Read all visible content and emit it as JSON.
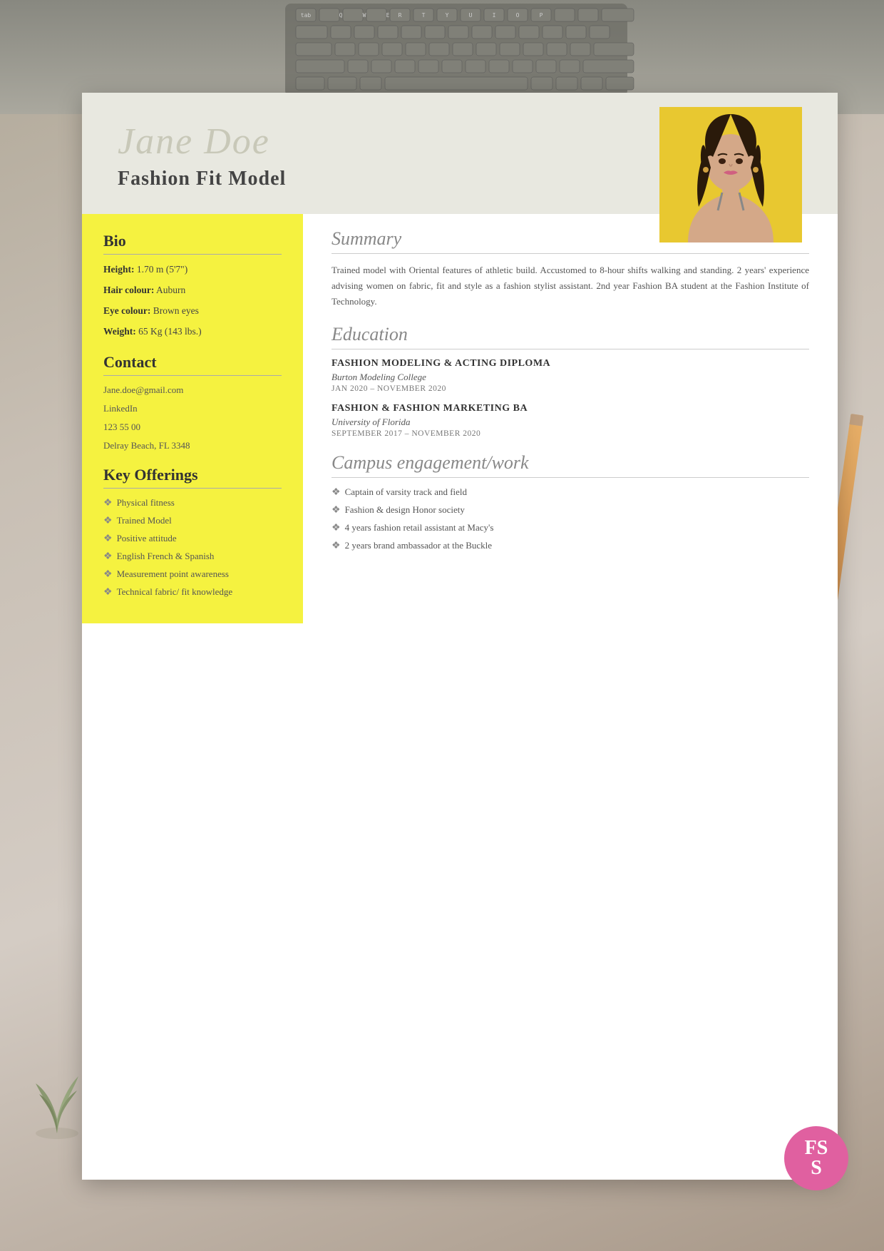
{
  "background": {
    "color": "#c0b8b0"
  },
  "resume": {
    "header": {
      "name": "Jane Doe",
      "title": "Fashion Fit Model"
    },
    "bio": {
      "section_title": "Bio",
      "items": [
        {
          "label": "Height:",
          "value": "1.70 m (5'7\")"
        },
        {
          "label": "Hair colour:",
          "value": "Auburn"
        },
        {
          "label": "Eye colour:",
          "value": "Brown eyes"
        },
        {
          "label": "Weight:",
          "value": "65 Kg (143 lbs.)"
        }
      ]
    },
    "contact": {
      "section_title": "Contact",
      "items": [
        "Jane.doe@gmail.com",
        "LinkedIn",
        "123 55 00",
        "Delray Beach, FL 3348"
      ]
    },
    "offerings": {
      "section_title": "Key Offerings",
      "items": [
        "Physical fitness",
        "Trained Model",
        "Positive attitude",
        "English French & Spanish",
        "Measurement point awareness",
        "Technical fabric/ fit knowledge"
      ]
    },
    "summary": {
      "section_title": "Summary",
      "text": "Trained model with Oriental features of athletic build. Accustomed to 8-hour shifts walking and standing. 2 years' experience advising women on fabric, fit and style as a fashion stylist assistant. 2nd year Fashion BA student at the Fashion Institute of Technology."
    },
    "education": {
      "section_title": "Education",
      "degrees": [
        {
          "degree": "Fashion Modeling & Acting Diploma",
          "school": "Burton Modeling College",
          "dates": "JAN  2020 – NOVEMBER 2020"
        },
        {
          "degree": "Fashion & Fashion Marketing BA",
          "school": "University of Florida",
          "dates": "SEPTEMBER  2017 – NOVEMBER 2020"
        }
      ]
    },
    "campus": {
      "section_title": "Campus engagement/work",
      "items": [
        "Captain of varsity track and field",
        "Fashion & design Honor society",
        "4 years fashion retail assistant at Macy's",
        "2 years brand ambassador at the Buckle"
      ]
    }
  },
  "badge": {
    "text_top": "FS",
    "text_bottom": "S"
  }
}
